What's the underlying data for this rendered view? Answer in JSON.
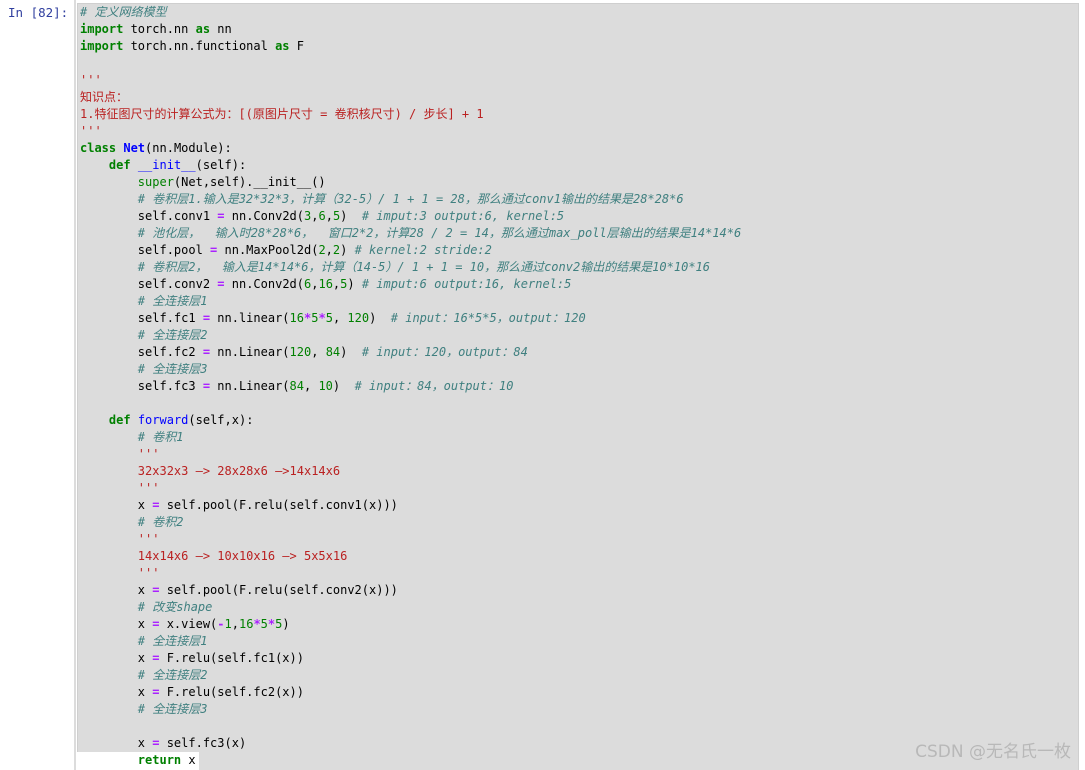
{
  "cell": {
    "prompt": "In  [82]:",
    "lines": [
      [
        [
          "cm",
          "# 定义网络模型"
        ]
      ],
      [
        [
          "kw",
          "import"
        ],
        [
          "txt",
          " torch.nn "
        ],
        [
          "kw",
          "as"
        ],
        [
          "txt",
          " nn"
        ]
      ],
      [
        [
          "kw",
          "import"
        ],
        [
          "txt",
          " torch.nn.functional "
        ],
        [
          "kw",
          "as"
        ],
        [
          "txt",
          " F"
        ]
      ],
      [
        [
          "txt",
          ""
        ]
      ],
      [
        [
          "str",
          "'''"
        ]
      ],
      [
        [
          "str",
          "知识点："
        ]
      ],
      [
        [
          "str",
          "1.特征图尺寸的计算公式为：[(原图片尺寸 = 卷积核尺寸) / 步长] + 1"
        ]
      ],
      [
        [
          "str",
          "'''"
        ]
      ],
      [
        [
          "kw",
          "class"
        ],
        [
          "txt",
          " "
        ],
        [
          "cls",
          "Net"
        ],
        [
          "txt",
          "(nn.Module):"
        ]
      ],
      [
        [
          "txt",
          "    "
        ],
        [
          "kw",
          "def"
        ],
        [
          "txt",
          " "
        ],
        [
          "dunder",
          "__init__"
        ],
        [
          "txt",
          "(self):"
        ]
      ],
      [
        [
          "txt",
          "        "
        ],
        [
          "bi",
          "super"
        ],
        [
          "txt",
          "(Net,self).__init__()"
        ]
      ],
      [
        [
          "txt",
          "        "
        ],
        [
          "cm",
          "# 卷积层1.输入是32*32*3，计算（32-5）/ 1 + 1 = 28，那么通过conv1输出的结果是28*28*6"
        ]
      ],
      [
        [
          "txt",
          "        self.conv1 "
        ],
        [
          "op",
          "="
        ],
        [
          "txt",
          " nn.Conv2d("
        ],
        [
          "num",
          "3"
        ],
        [
          "txt",
          ","
        ],
        [
          "num",
          "6"
        ],
        [
          "txt",
          ","
        ],
        [
          "num",
          "5"
        ],
        [
          "txt",
          ")  "
        ],
        [
          "cm",
          "# imput:3 output:6, kernel:5"
        ]
      ],
      [
        [
          "txt",
          "        "
        ],
        [
          "cm",
          "# 池化层，  输入时28*28*6，  窗口2*2，计算28 / 2 = 14，那么通过max_poll层输出的结果是14*14*6"
        ]
      ],
      [
        [
          "txt",
          "        self.pool "
        ],
        [
          "op",
          "="
        ],
        [
          "txt",
          " nn.MaxPool2d("
        ],
        [
          "num",
          "2"
        ],
        [
          "txt",
          ","
        ],
        [
          "num",
          "2"
        ],
        [
          "txt",
          ") "
        ],
        [
          "cm",
          "# kernel:2 stride:2"
        ]
      ],
      [
        [
          "txt",
          "        "
        ],
        [
          "cm",
          "# 卷积层2，  输入是14*14*6，计算（14-5）/ 1 + 1 = 10，那么通过conv2输出的结果是10*10*16"
        ]
      ],
      [
        [
          "txt",
          "        self.conv2 "
        ],
        [
          "op",
          "="
        ],
        [
          "txt",
          " nn.Conv2d("
        ],
        [
          "num",
          "6"
        ],
        [
          "txt",
          ","
        ],
        [
          "num",
          "16"
        ],
        [
          "txt",
          ","
        ],
        [
          "num",
          "5"
        ],
        [
          "txt",
          ") "
        ],
        [
          "cm",
          "# imput:6 output:16, kernel:5"
        ]
      ],
      [
        [
          "txt",
          "        "
        ],
        [
          "cm",
          "# 全连接层1"
        ]
      ],
      [
        [
          "txt",
          "        self.fc1 "
        ],
        [
          "op",
          "="
        ],
        [
          "txt",
          " nn.linear("
        ],
        [
          "num",
          "16"
        ],
        [
          "op",
          "*"
        ],
        [
          "num",
          "5"
        ],
        [
          "op",
          "*"
        ],
        [
          "num",
          "5"
        ],
        [
          "txt",
          ", "
        ],
        [
          "num",
          "120"
        ],
        [
          "txt",
          ")  "
        ],
        [
          "cm",
          "# input：16*5*5，output：120"
        ]
      ],
      [
        [
          "txt",
          "        "
        ],
        [
          "cm",
          "# 全连接层2"
        ]
      ],
      [
        [
          "txt",
          "        self.fc2 "
        ],
        [
          "op",
          "="
        ],
        [
          "txt",
          " nn.Linear("
        ],
        [
          "num",
          "120"
        ],
        [
          "txt",
          ", "
        ],
        [
          "num",
          "84"
        ],
        [
          "txt",
          ")  "
        ],
        [
          "cm",
          "# input：120，output：84"
        ]
      ],
      [
        [
          "txt",
          "        "
        ],
        [
          "cm",
          "# 全连接层3"
        ]
      ],
      [
        [
          "txt",
          "        self.fc3 "
        ],
        [
          "op",
          "="
        ],
        [
          "txt",
          " nn.Linear("
        ],
        [
          "num",
          "84"
        ],
        [
          "txt",
          ", "
        ],
        [
          "num",
          "10"
        ],
        [
          "txt",
          ")  "
        ],
        [
          "cm",
          "# input：84，output：10"
        ]
      ],
      [
        [
          "txt",
          ""
        ]
      ],
      [
        [
          "txt",
          "    "
        ],
        [
          "kw",
          "def"
        ],
        [
          "txt",
          " "
        ],
        [
          "fn",
          "forward"
        ],
        [
          "txt",
          "(self,x):"
        ]
      ],
      [
        [
          "txt",
          "        "
        ],
        [
          "cm",
          "# 卷积1"
        ]
      ],
      [
        [
          "txt",
          "        "
        ],
        [
          "str",
          "'''"
        ]
      ],
      [
        [
          "txt",
          "        "
        ],
        [
          "str",
          "32x32x3 —> 28x28x6 —>14x14x6"
        ]
      ],
      [
        [
          "txt",
          "        "
        ],
        [
          "str",
          "'''"
        ]
      ],
      [
        [
          "txt",
          "        x "
        ],
        [
          "op",
          "="
        ],
        [
          "txt",
          " self.pool(F.relu(self.conv1(x)))"
        ]
      ],
      [
        [
          "txt",
          "        "
        ],
        [
          "cm",
          "# 卷积2"
        ]
      ],
      [
        [
          "txt",
          "        "
        ],
        [
          "str",
          "'''"
        ]
      ],
      [
        [
          "txt",
          "        "
        ],
        [
          "str",
          "14x14x6 —> 10x10x16 —> 5x5x16"
        ]
      ],
      [
        [
          "txt",
          "        "
        ],
        [
          "str",
          "'''"
        ]
      ],
      [
        [
          "txt",
          "        x "
        ],
        [
          "op",
          "="
        ],
        [
          "txt",
          " self.pool(F.relu(self.conv2(x)))"
        ]
      ],
      [
        [
          "txt",
          "        "
        ],
        [
          "cm",
          "# 改变shape"
        ]
      ],
      [
        [
          "txt",
          "        x "
        ],
        [
          "op",
          "="
        ],
        [
          "txt",
          " x.view("
        ],
        [
          "op",
          "-"
        ],
        [
          "num",
          "1"
        ],
        [
          "txt",
          ","
        ],
        [
          "num",
          "16"
        ],
        [
          "op",
          "*"
        ],
        [
          "num",
          "5"
        ],
        [
          "op",
          "*"
        ],
        [
          "num",
          "5"
        ],
        [
          "txt",
          ")"
        ]
      ],
      [
        [
          "txt",
          "        "
        ],
        [
          "cm",
          "# 全连接层1"
        ]
      ],
      [
        [
          "txt",
          "        x "
        ],
        [
          "op",
          "="
        ],
        [
          "txt",
          " F.relu(self.fc1(x))"
        ]
      ],
      [
        [
          "txt",
          "        "
        ],
        [
          "cm",
          "# 全连接层2"
        ]
      ],
      [
        [
          "txt",
          "        x "
        ],
        [
          "op",
          "="
        ],
        [
          "txt",
          " F.relu(self.fc2(x))"
        ]
      ],
      [
        [
          "txt",
          "        "
        ],
        [
          "cm",
          "# 全连接层3"
        ]
      ],
      [
        [
          "txt",
          ""
        ]
      ],
      [
        [
          "txt",
          "        x "
        ],
        [
          "op",
          "="
        ],
        [
          "txt",
          " self.fc3(x)"
        ]
      ]
    ],
    "last_line": [
      [
        "txt",
        "        "
      ],
      [
        "kw",
        "return"
      ],
      [
        "txt",
        " x"
      ]
    ]
  },
  "watermark": "CSDN @无名氏一枚"
}
